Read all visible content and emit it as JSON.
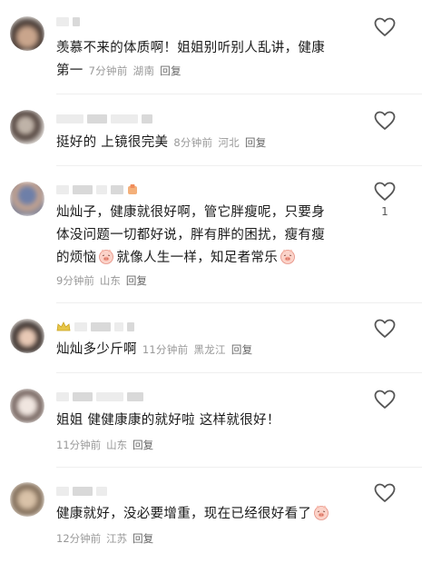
{
  "comments": [
    {
      "text_lines": [
        "羡慕不来的体质啊！姐姐别听别人乱讲，健康",
        "第一"
      ],
      "time": "7分钟前",
      "location": "湖南",
      "reply_label": "回复",
      "meta_inline": true,
      "like_count": ""
    },
    {
      "text_lines": [
        "挺好的 上镜很完美"
      ],
      "time": "8分钟前",
      "location": "河北",
      "reply_label": "回复",
      "meta_inline": true,
      "like_count": ""
    },
    {
      "text_lines": [
        "灿灿子，健康就很好啊，管它胖瘦呢，只要身",
        "体没问题一切都好说，胖有胖的困扰，瘦有瘦",
        "的烦恼",
        "就像人生一样，知足者常乐"
      ],
      "time": "9分钟前",
      "location": "山东",
      "reply_label": "回复",
      "meta_inline": false,
      "like_count": "1"
    },
    {
      "text_lines": [
        "灿灿多少斤啊"
      ],
      "time": "11分钟前",
      "location": "黑龙江",
      "reply_label": "回复",
      "meta_inline": true,
      "like_count": ""
    },
    {
      "text_lines": [
        "姐姐 健健康康的就好啦 这样就很好！"
      ],
      "time": "11分钟前",
      "location": "山东",
      "reply_label": "回复",
      "meta_inline": false,
      "like_count": ""
    },
    {
      "text_lines": [
        "健康就好，没必要增重，现在已经很好看了"
      ],
      "time": "12分钟前",
      "location": "江苏",
      "reply_label": "回复",
      "meta_inline": false,
      "like_count": ""
    }
  ],
  "icons": {
    "like": "heart-outline-icon",
    "emoji": "pig-face-emoji-icon",
    "badge": "crown-badge-icon"
  },
  "colors": {
    "meta": "#999999",
    "reply": "#666666",
    "text": "#1a1a1a"
  }
}
